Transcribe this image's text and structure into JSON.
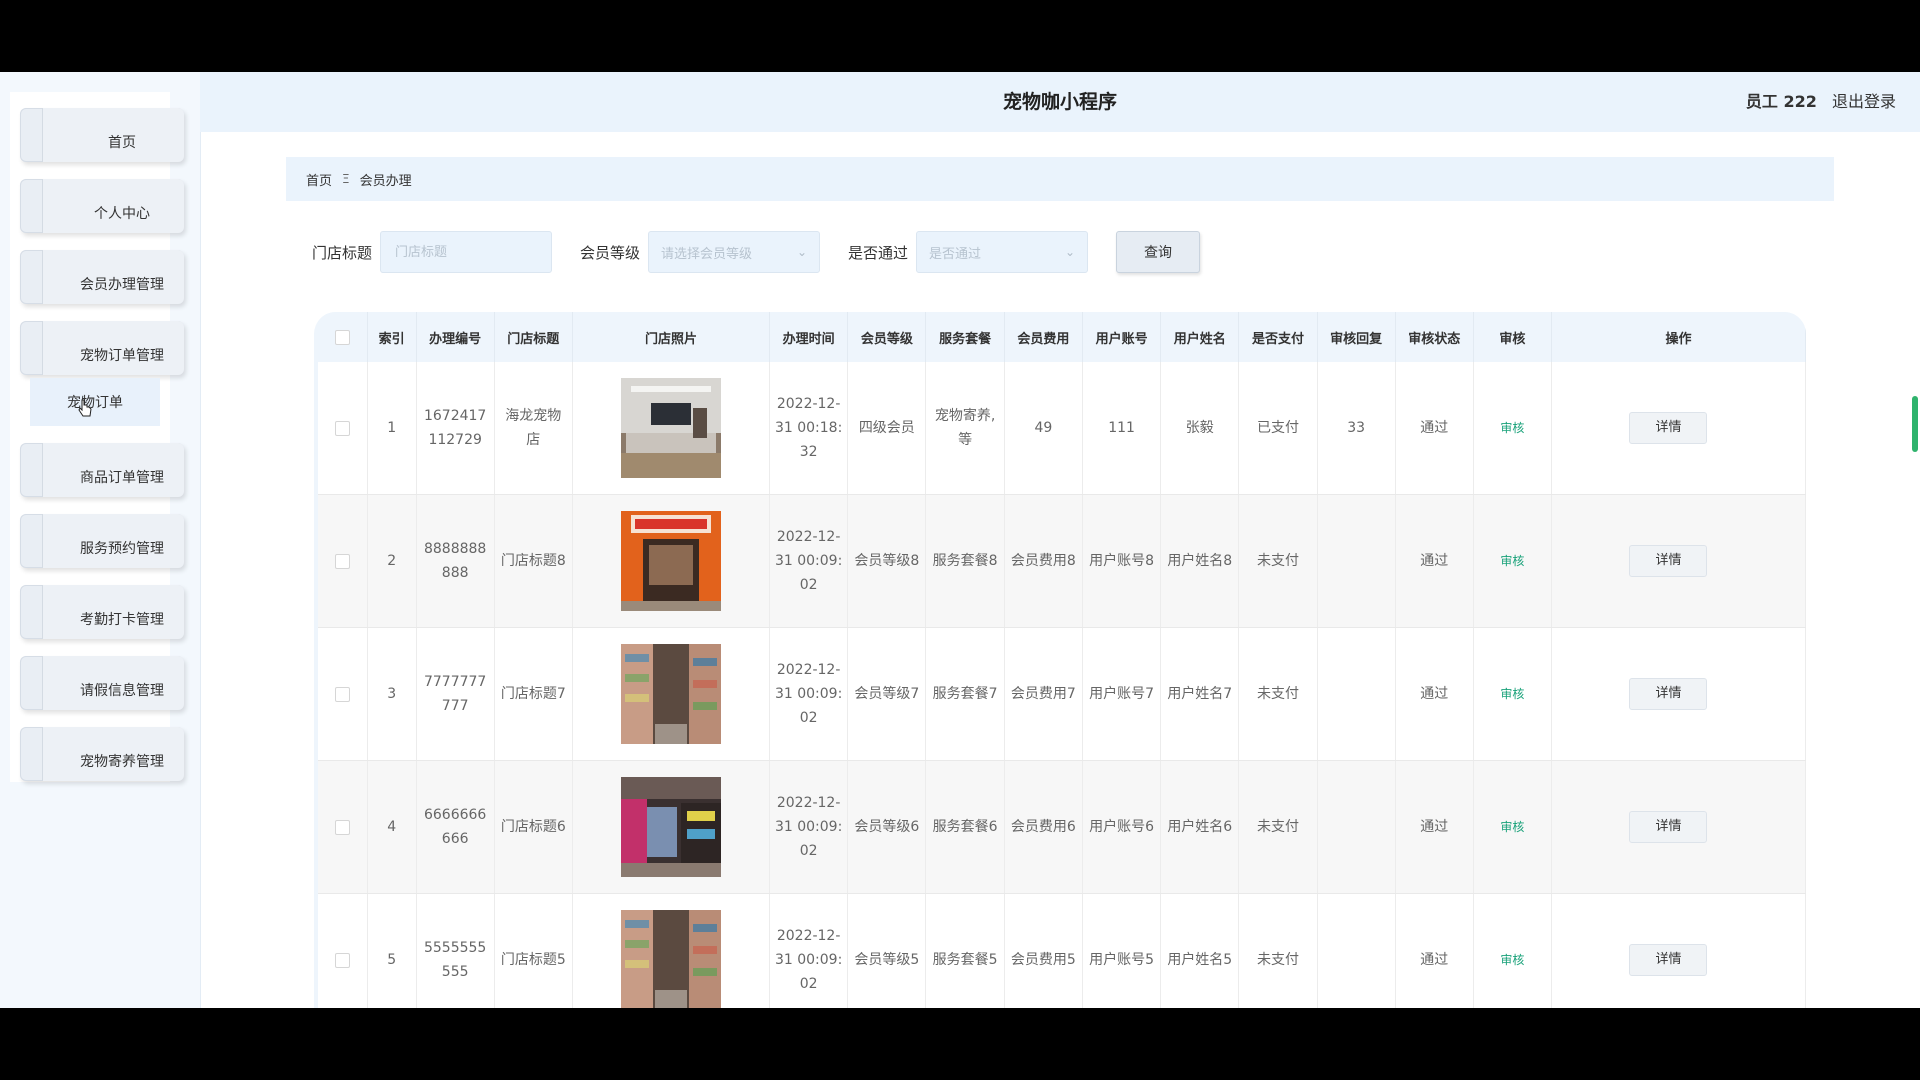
{
  "app": {
    "title": "宠物咖小程序",
    "user_label": "员工 222",
    "logout_label": "退出登录"
  },
  "sidebar": {
    "items": [
      {
        "label": "首页"
      },
      {
        "label": "个人中心"
      },
      {
        "label": "会员办理管理"
      },
      {
        "label": "宠物订单管理"
      },
      {
        "label": "商品订单管理"
      },
      {
        "label": "服务预约管理"
      },
      {
        "label": "考勤打卡管理"
      },
      {
        "label": "请假信息管理"
      },
      {
        "label": "宠物寄养管理"
      }
    ],
    "submenu": {
      "label": "宠物订单"
    }
  },
  "breadcrumb": {
    "home": "首页",
    "separator": "Ξ",
    "current": "会员办理"
  },
  "filters": {
    "store_title_label": "门店标题",
    "store_title_placeholder": "门店标题",
    "level_label": "会员等级",
    "level_placeholder": "请选择会员等级",
    "passed_label": "是否通过",
    "passed_placeholder": "是否通过",
    "search_label": "查询"
  },
  "table": {
    "columns": [
      "索引",
      "办理编号",
      "门店标题",
      "门店照片",
      "办理时间",
      "会员等级",
      "服务套餐",
      "会员费用",
      "用户账号",
      "用户姓名",
      "是否支付",
      "审核回复",
      "审核状态",
      "审核",
      "操作"
    ],
    "audit_label": "审核",
    "detail_label": "详情",
    "rows": [
      {
        "index": "1",
        "code": "1672417112729",
        "store": "海龙宠物店",
        "time": "2022-12-31 00:18:32",
        "level": "四级会员",
        "package": "宠物寄养,等",
        "fee": "49",
        "account": "111",
        "name": "张毅",
        "paid": "已支付",
        "reply": "33",
        "status": "通过"
      },
      {
        "index": "2",
        "code": "8888888888",
        "store": "门店标题8",
        "time": "2022-12-31 00:09:02",
        "level": "会员等级8",
        "package": "服务套餐8",
        "fee": "会员费用8",
        "account": "用户账号8",
        "name": "用户姓名8",
        "paid": "未支付",
        "reply": "",
        "status": "通过"
      },
      {
        "index": "3",
        "code": "7777777777",
        "store": "门店标题7",
        "time": "2022-12-31 00:09:02",
        "level": "会员等级7",
        "package": "服务套餐7",
        "fee": "会员费用7",
        "account": "用户账号7",
        "name": "用户姓名7",
        "paid": "未支付",
        "reply": "",
        "status": "通过"
      },
      {
        "index": "4",
        "code": "6666666666",
        "store": "门店标题6",
        "time": "2022-12-31 00:09:02",
        "level": "会员等级6",
        "package": "服务套餐6",
        "fee": "会员费用6",
        "account": "用户账号6",
        "name": "用户姓名6",
        "paid": "未支付",
        "reply": "",
        "status": "通过"
      },
      {
        "index": "5",
        "code": "5555555555",
        "store": "门店标题5",
        "time": "2022-12-31 00:09:02",
        "level": "会员等级5",
        "package": "服务套餐5",
        "fee": "会员费用5",
        "account": "用户账号5",
        "name": "用户姓名5",
        "paid": "未支付",
        "reply": "",
        "status": "通过"
      }
    ]
  },
  "colors": {
    "accent": "#eaf3fc",
    "audit_link": "#1aa27a",
    "scrollbar": "#2fb36d"
  }
}
